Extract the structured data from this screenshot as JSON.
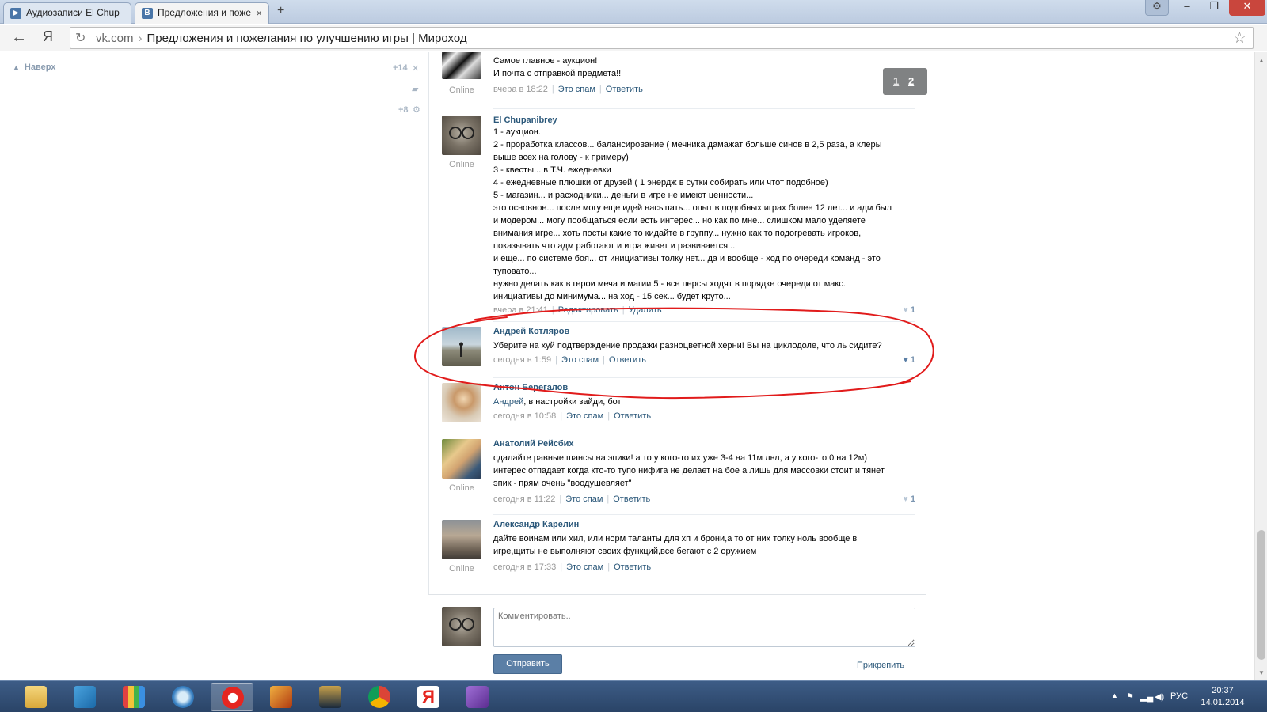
{
  "browser": {
    "tabs": [
      {
        "title": "Аудиозаписи El Chup",
        "icon": "play-icon",
        "active": false
      },
      {
        "title": "Предложения и поже",
        "icon": "vk-icon",
        "active": true
      }
    ],
    "new_tab_glyph": "+",
    "back_glyph": "←",
    "yandex_glyph": "Я",
    "reload_glyph": "↻",
    "url_host": "vk.com",
    "url_sep": "›",
    "url_title": "Предложения и пожелания по улучшению игры | Мироход",
    "star_glyph": "☆",
    "settings_glyph": "⚙",
    "minimize_glyph": "–",
    "restore_glyph": "❐",
    "close_glyph": "✕"
  },
  "left_panel": {
    "back_to_top": "Наверх",
    "counter_top": "+14",
    "counter_bottom": "+8"
  },
  "pager": {
    "pages": [
      "1",
      "2"
    ]
  },
  "comments": [
    {
      "author": "",
      "lines": [
        "Самое главное - аукцион!",
        "И почта с отправкой предмета!!"
      ],
      "online": "Online",
      "time": "вчера в 18:22",
      "actions": [
        "Это спам",
        "Ответить"
      ],
      "likes": ""
    },
    {
      "author": "El Chupanibrey",
      "lines": [
        "1 - аукцион.",
        "2 - проработка классов... балансирование ( мечника дамажат больше синов в 2,5 раза, а клеры",
        "выше всех на голову - к примеру)",
        "3 - квесты... в Т.Ч. ежедневки",
        "4 - ежедневные плюшки от друзей ( 1 энердж в сутки собирать или чтот подобное)",
        "5 - магазин... и расходники... деньги в игре не имеют ценности...",
        "это основное... после могу еще идей насыпать... опыт в подобных играх более 12 лет... и адм был",
        "и модером... могу пообщаться если есть интерес... но как по мне... слишком мало уделяете",
        "внимания игре... хоть посты какие то кидайте в группу... нужно как то подогревать игроков,",
        "показывать что адм работают и игра живет и развивается...",
        "и еще... по системе боя... от инициативы толку нет... да и вообще - ход по очереди команд - это",
        "туповато...",
        "нужно делать как в герои меча и магии 5 - все персы ходят в порядке очереди от макс.",
        "инициативы до минимума... на ход - 15 сек... будет круто..."
      ],
      "online": "Online",
      "time": "вчера в 21:41",
      "actions": [
        "Редактировать",
        "Удалить"
      ],
      "likes": "1"
    },
    {
      "author": "Андрей Котляров",
      "lines": [
        "Уберите на хуй подтверждение продажи разноцветной херни! Вы на циклодоле, что ль сидите?"
      ],
      "online": "",
      "time": "сегодня в 1:59",
      "actions": [
        "Это спам",
        "Ответить"
      ],
      "likes": "1"
    },
    {
      "author": "Антон Берегалов",
      "reply_to": "Андрей",
      "lines": [
        ", в настройки зайди, бот"
      ],
      "online": "",
      "time": "сегодня в 10:58",
      "actions": [
        "Это спам",
        "Ответить"
      ],
      "likes": ""
    },
    {
      "author": "Анатолий Рейсбих",
      "lines": [
        "сдалайте равные шансы на эпики! а то у кого-то их уже 3-4 на 11м лвл, а у кого-то 0 на 12м)",
        "интерес отпадает когда кто-то тупо нифига не делает на бое а лишь для массовки стоит и тянет",
        "эпик - прям очень \"воодушевляет\""
      ],
      "online": "Online",
      "time": "сегодня в 11:22",
      "actions": [
        "Это спам",
        "Ответить"
      ],
      "likes": "1"
    },
    {
      "author": "Александр Карелин",
      "lines": [
        "дайте воинам или хил, или норм таланты для хп и брони,а то от них толку ноль вообще в",
        "игре,щиты не выполняют своих функций,все бегают с 2 оружием"
      ],
      "online": "Online",
      "time": "сегодня в 17:33",
      "actions": [
        "Это спам",
        "Ответить"
      ],
      "likes": ""
    }
  ],
  "reply_form": {
    "placeholder": "Комментировать..",
    "send_label": "Отправить",
    "attach_label": "Прикрепить"
  },
  "taskbar": {
    "language": "РУС",
    "time": "20:37",
    "date": "14.01.2014",
    "apps": [
      "file-explorer-icon",
      "rocket-app-icon",
      "color-grid-app-icon",
      "download-app-icon",
      "yandex-browser-icon",
      "game-n-icon",
      "league-of-legends-icon",
      "chrome-icon",
      "yandex-icon",
      "visual-studio-icon"
    ]
  },
  "colors": {
    "link": "#2b587a",
    "button": "#5b7fa6",
    "annotation": "#e11b1b",
    "taskbar": "#2f4a70"
  }
}
